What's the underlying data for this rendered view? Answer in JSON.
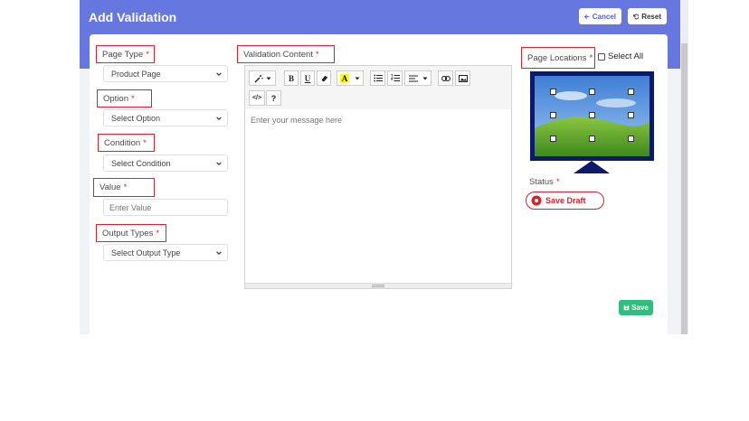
{
  "header": {
    "title": "Add Validation",
    "cancel_label": "Cancel",
    "reset_label": "Reset"
  },
  "form": {
    "page_type": {
      "label": "Page Type",
      "required": "*",
      "value": "Product Page"
    },
    "option": {
      "label": "Option",
      "required": "*",
      "value": "Select Option"
    },
    "condition": {
      "label": "Condition",
      "required": "*",
      "value": "Select Condition"
    },
    "value": {
      "label": "Value",
      "required": "*",
      "placeholder": "Enter Value"
    },
    "output_types": {
      "label": "Output Types",
      "required": "*",
      "value": "Select Output Type"
    }
  },
  "editor": {
    "label": "Validation Content",
    "required": "*",
    "placeholder": "Enter your message here",
    "toolbar": {
      "bold": "B",
      "underline": "U",
      "help": "?",
      "code": "</>"
    }
  },
  "locations": {
    "label": "Page Locations",
    "required": "*",
    "select_all_label": "Select All"
  },
  "status": {
    "label": "Status",
    "required": "*",
    "draft_label": "Save Draft"
  },
  "actions": {
    "save_label": "Save"
  },
  "colors": {
    "header_bg": "#6777e0",
    "highlight_border": "#d8232a",
    "save_green": "#2fbf7d",
    "monitor": "#0c1a6b"
  }
}
